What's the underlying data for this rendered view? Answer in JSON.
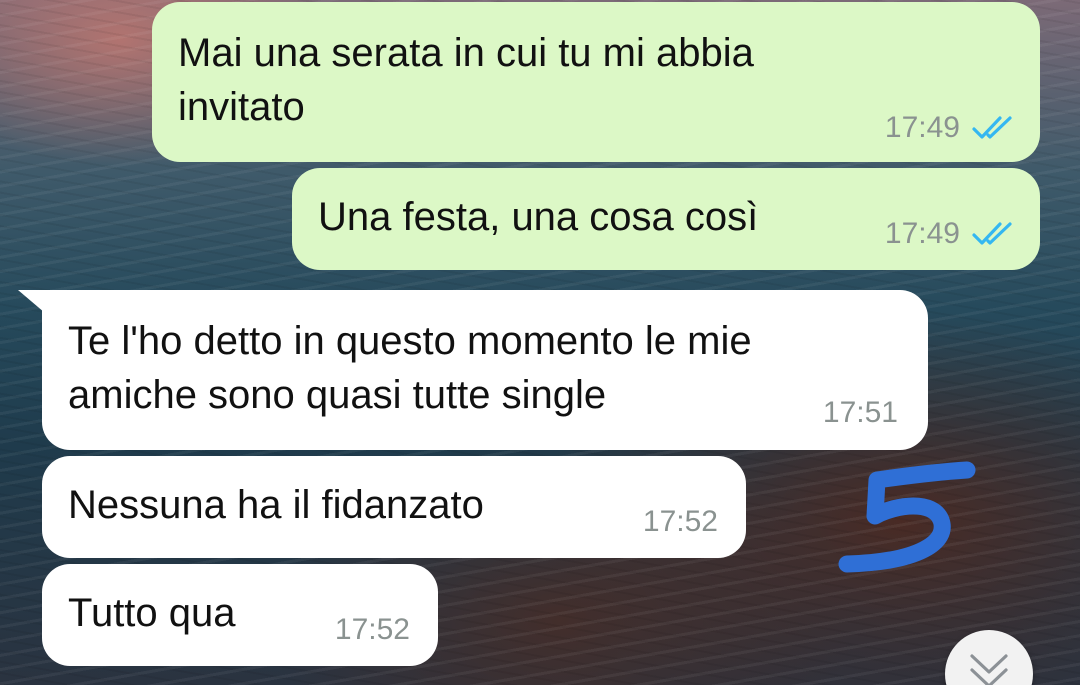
{
  "messages": [
    {
      "text": "Mai una serata in cui tu mi abbia\ninvitato",
      "time": "17:49",
      "direction": "out",
      "status": "read"
    },
    {
      "text": "Una festa, una cosa così",
      "time": "17:49",
      "direction": "out",
      "status": "read"
    },
    {
      "text": "Te l'ho detto in questo momento le mie\namiche sono quasi tutte single",
      "time": "17:51",
      "direction": "in"
    },
    {
      "text": "Nessuna ha il fidanzato",
      "time": "17:52",
      "direction": "in"
    },
    {
      "text": "Tutto qua",
      "time": "17:52",
      "direction": "in"
    }
  ],
  "annotation": {
    "text": "5",
    "color": "#2f6fd6"
  },
  "colors": {
    "outgoing_bubble": "#dcf8c6",
    "incoming_bubble": "#ffffff",
    "read_ticks": "#34b7f1",
    "timestamp": "#8a9290"
  },
  "icons": {
    "read_receipt": "double-check-icon",
    "scroll_down": "chevron-double-down-icon"
  }
}
